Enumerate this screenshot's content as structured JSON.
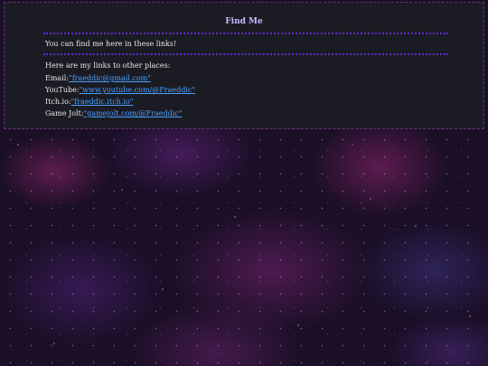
{
  "page": {
    "title": "Find Me",
    "intro": "You can find me here in these links!",
    "subheading": "Here are my links to other places:"
  },
  "links": [
    {
      "label": "Email:",
      "value": "\"fraeddic@gmail.com\""
    },
    {
      "label": "YouTube:",
      "value": "\"www.youtube.com/@Fraeddic\""
    },
    {
      "label": "Itch.io:",
      "value": "\"fraeddic.itch.io\""
    },
    {
      "label": "Game Jolt:",
      "value": "\"gamejolt.com/@Fraeddic\""
    }
  ],
  "colors": {
    "panel_background": "#1b1b23",
    "title": "#c9b8ff",
    "link": "#4aa0ff",
    "divider": "#5b2ec9",
    "panel_border": "#6a2f7e"
  }
}
